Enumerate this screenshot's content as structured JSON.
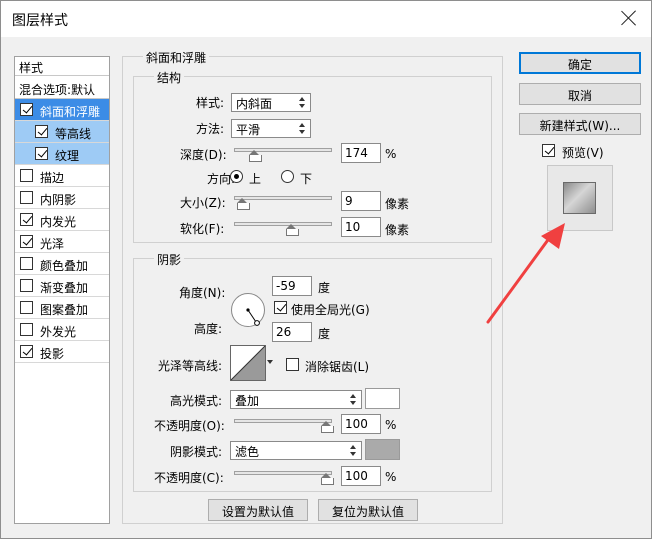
{
  "window": {
    "title": "图层样式"
  },
  "stylelist": {
    "header": "样式",
    "blend": "混合选项:默认",
    "items": [
      {
        "label": "斜面和浮雕",
        "checked": true,
        "state": "selected"
      },
      {
        "label": "等高线",
        "checked": true,
        "state": "sub"
      },
      {
        "label": "纹理",
        "checked": true,
        "state": "sub"
      },
      {
        "label": "描边",
        "checked": false
      },
      {
        "label": "内阴影",
        "checked": false
      },
      {
        "label": "内发光",
        "checked": true
      },
      {
        "label": "光泽",
        "checked": true
      },
      {
        "label": "颜色叠加",
        "checked": false
      },
      {
        "label": "渐变叠加",
        "checked": false
      },
      {
        "label": "图案叠加",
        "checked": false
      },
      {
        "label": "外发光",
        "checked": false
      },
      {
        "label": "投影",
        "checked": true
      }
    ]
  },
  "bevel": {
    "title": "斜面和浮雕",
    "structure": {
      "title": "结构",
      "style_label": "样式:",
      "style_value": "内斜面",
      "technique_label": "方法:",
      "technique_value": "平滑",
      "depth_label": "深度(D):",
      "depth_value": "174",
      "depth_unit": "%",
      "depth_fraction": 0.17,
      "direction_label": "方向:",
      "direction_up": "上",
      "direction_down": "下",
      "size_label": "大小(Z):",
      "size_value": "9",
      "size_unit": "像素",
      "size_fraction": 0.04,
      "soften_label": "软化(F):",
      "soften_value": "10",
      "soften_unit": "像素",
      "soften_fraction": 0.6
    },
    "shading": {
      "title": "阴影",
      "angle_label": "角度(N):",
      "angle_value": "-59",
      "angle_unit": "度",
      "global_light_label": "使用全局光(G)",
      "altitude_label": "高度:",
      "altitude_value": "26",
      "altitude_unit": "度",
      "gloss_contour_label": "光泽等高线:",
      "antialias_label": "消除锯齿(L)",
      "highlight_mode_label": "高光模式:",
      "highlight_mode_value": "叠加",
      "highlight_color": "#ffffff",
      "highlight_opacity_label": "不透明度(O):",
      "highlight_opacity_value": "100",
      "highlight_opacity_unit": "%",
      "highlight_opacity_fraction": 1.0,
      "shadow_mode_label": "阴影模式:",
      "shadow_mode_value": "滤色",
      "shadow_color": "#aaaaaa",
      "shadow_opacity_label": "不透明度(C):",
      "shadow_opacity_value": "100",
      "shadow_opacity_unit": "%",
      "shadow_opacity_fraction": 1.0
    },
    "make_default": "设置为默认值",
    "reset_default": "复位为默认值"
  },
  "buttons": {
    "ok": "确定",
    "cancel": "取消",
    "new_style": "新建样式(W)...",
    "preview": "预览(V)"
  },
  "colors": {
    "selected": "#3c8ce6",
    "sub_selected": "#9ecbf5",
    "annotation_arrow": "#f04040"
  }
}
